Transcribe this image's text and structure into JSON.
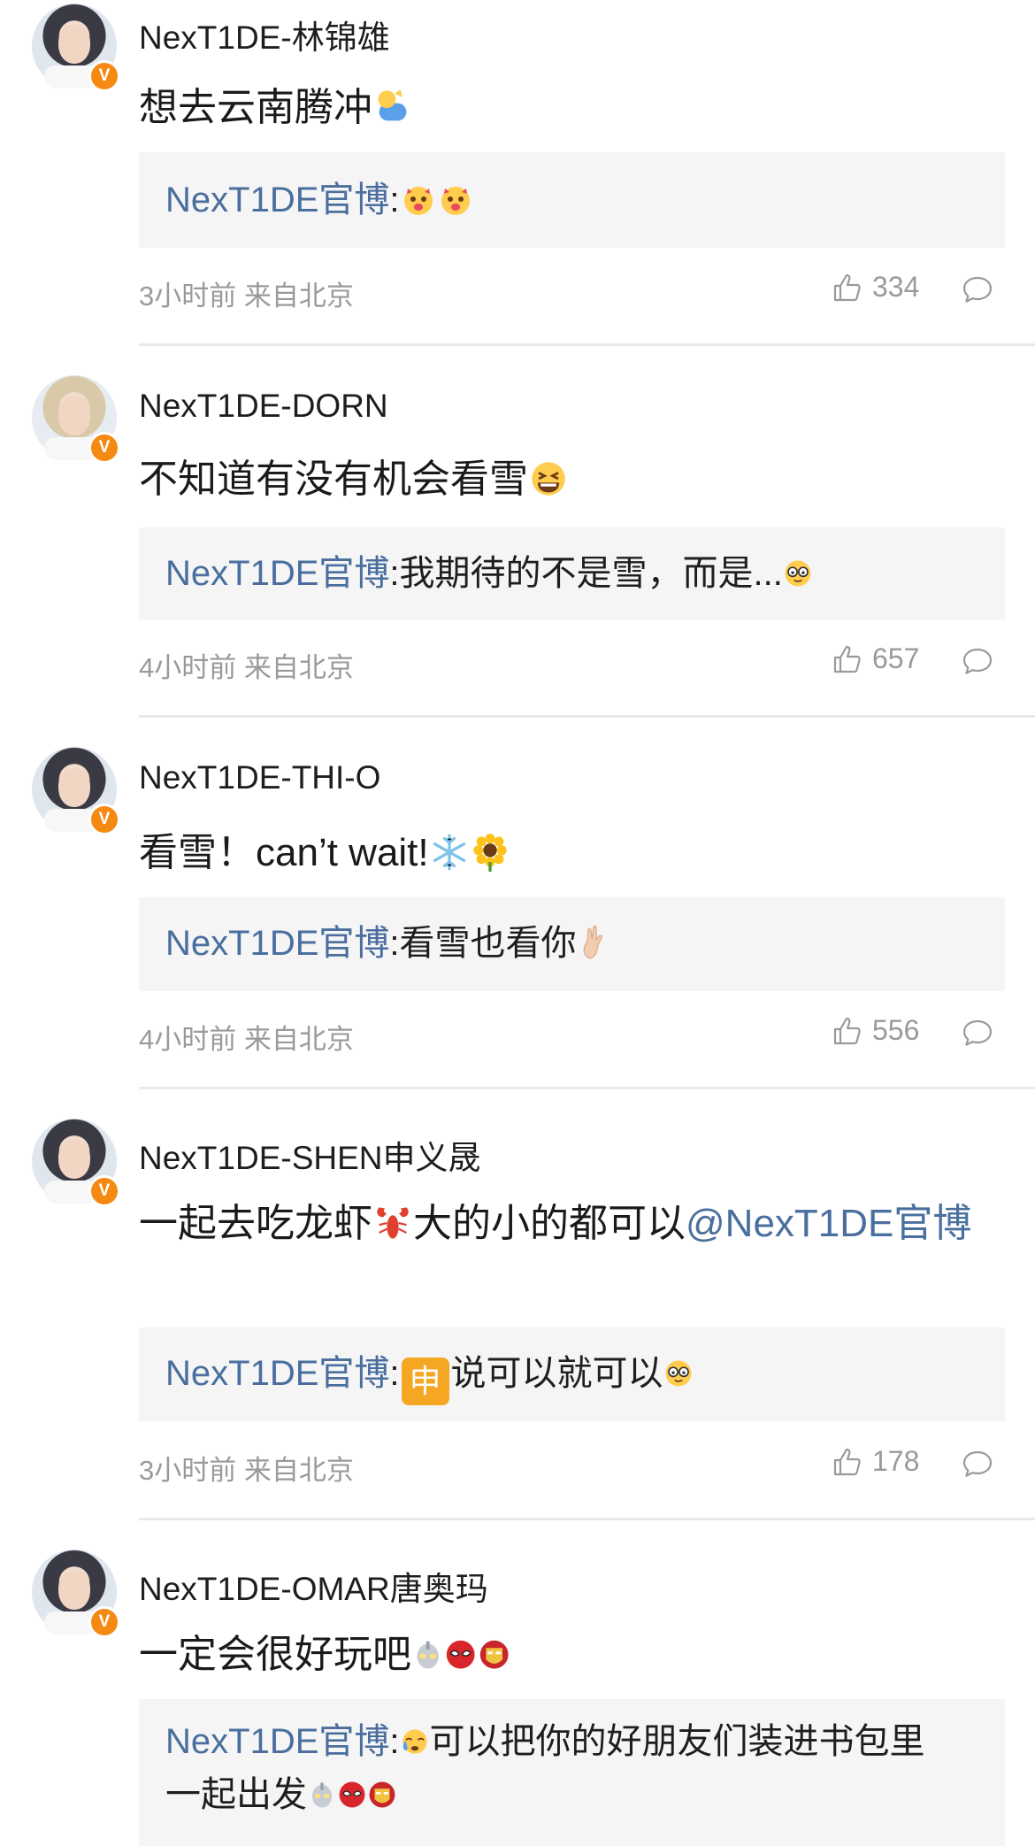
{
  "comments": [
    {
      "name": "NexT1DE-林锦雄",
      "text": "想去云南腾冲",
      "reply_author": "NexT1DE官博",
      "reply_text": "",
      "time": "3小时前 来自北京",
      "likes": "334"
    },
    {
      "name": "NexT1DE-DORN",
      "text": "不知道有没有机会看雪",
      "reply_author": "NexT1DE官博",
      "reply_text": "我期待的不是雪，而是...",
      "time": "4小时前 来自北京",
      "likes": "657"
    },
    {
      "name": "NexT1DE-THI-O",
      "text": "看雪！can’t wait!",
      "reply_author": "NexT1DE官博",
      "reply_text": "看雪也看你",
      "time": "4小时前 来自北京",
      "likes": "556"
    },
    {
      "name": "NexT1DE-SHEN申义晟",
      "text_before": "一起去吃龙虾",
      "text_after": "大的小的都可以",
      "mention": "@NexT1DE官博",
      "reply_author": "NexT1DE官博",
      "reply_badge": "申",
      "reply_text": "说可以就可以",
      "time": "3小时前 来自北京",
      "likes": "178"
    },
    {
      "name": "NexT1DE-OMAR唐奥玛",
      "text": "一定会很好玩吧",
      "reply_author": "NexT1DE官博",
      "reply_text_line1": "可以把你的好朋友们装进书包里",
      "reply_text_line2": "一起出发"
    }
  ],
  "colors": {
    "link": "#4a6f9e",
    "verified_badge": "#f58a12",
    "reply_bg": "#f5f5f5",
    "meta": "#9a9a9a"
  },
  "icons": {
    "verified": "V",
    "like": "thumbs-up-icon",
    "reply": "speech-bubble-icon"
  }
}
